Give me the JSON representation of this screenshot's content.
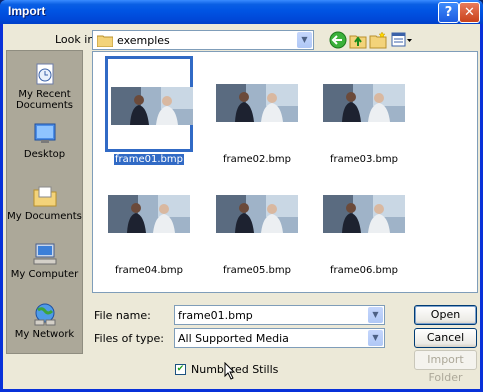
{
  "window": {
    "title": "Import",
    "help_glyph": "?",
    "close_glyph": "✕"
  },
  "toolbar": {
    "look_in_label": "Look in:",
    "look_in_value": "exemples",
    "icons": [
      "back-arrow-icon",
      "up-folder-icon",
      "new-folder-icon",
      "view-menu-icon"
    ]
  },
  "places": [
    {
      "label": "My Recent Documents",
      "icon": "recent-documents-icon"
    },
    {
      "label": "Desktop",
      "icon": "desktop-icon"
    },
    {
      "label": "My Documents",
      "icon": "my-documents-icon"
    },
    {
      "label": "My Computer",
      "icon": "my-computer-icon"
    },
    {
      "label": "My Network",
      "icon": "my-network-icon"
    }
  ],
  "files": [
    {
      "name": "frame01.bmp",
      "selected": true
    },
    {
      "name": "frame02.bmp",
      "selected": false
    },
    {
      "name": "frame03.bmp",
      "selected": false
    },
    {
      "name": "frame04.bmp",
      "selected": false
    },
    {
      "name": "frame05.bmp",
      "selected": false
    },
    {
      "name": "frame06.bmp",
      "selected": false
    }
  ],
  "form": {
    "file_name_label": "File name:",
    "file_name_value": "frame01.bmp",
    "files_of_type_label": "Files of type:",
    "files_of_type_value": "All Supported Media",
    "numbered_stills_label": "Numbered Stills",
    "numbered_stills_checked": true
  },
  "buttons": {
    "open": "Open",
    "cancel": "Cancel",
    "import_folder": "Import Folder"
  },
  "colors": {
    "title_bar": "#0054e3",
    "selection": "#316ac5",
    "dialog_bg": "#ece9d8"
  }
}
